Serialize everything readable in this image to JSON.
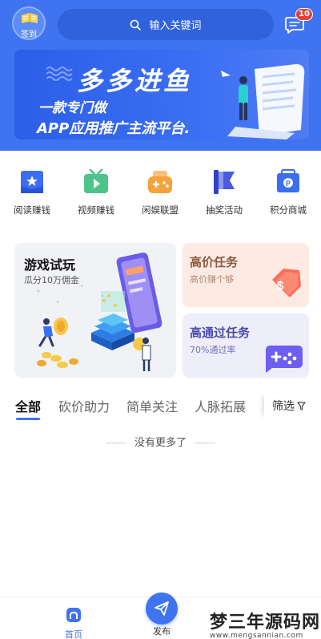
{
  "header": {
    "checkin_label": "签到",
    "search_placeholder": "输入关键词",
    "message_badge": "10",
    "accent": "#3f73f0"
  },
  "banner": {
    "title": "多多进鱼",
    "subtitle_line1": "一款专门做",
    "subtitle_line2": "APP应用推广主流平台."
  },
  "categories": [
    {
      "label": "阅读赚钱",
      "icon": "book-star-icon",
      "color": "#3b6ef3"
    },
    {
      "label": "视频赚钱",
      "icon": "video-icon",
      "color": "#4cc48a"
    },
    {
      "label": "闲娱联盟",
      "icon": "gamepad-icon",
      "color": "#f5a23b"
    },
    {
      "label": "抽奖活动",
      "icon": "flag-icon",
      "color": "#4a5be0"
    },
    {
      "label": "积分商城",
      "icon": "points-mall-icon",
      "color": "#3b6ef3"
    }
  ],
  "cards": {
    "game": {
      "title": "游戏试玩",
      "subtitle": "瓜分10万佣金"
    },
    "high_price": {
      "title": "高价任务",
      "subtitle": "高价赚个够"
    },
    "high_pass": {
      "title": "高通过任务",
      "subtitle": "70%通过率"
    }
  },
  "tabs": [
    {
      "label": "全部",
      "active": true
    },
    {
      "label": "砍价助力",
      "active": false
    },
    {
      "label": "简单关注",
      "active": false
    },
    {
      "label": "人脉拓展",
      "active": false
    }
  ],
  "filter_label": "筛选",
  "empty_text": "没有更多了",
  "tabbar": {
    "home_label": "首页",
    "publish_label": "发布"
  },
  "watermark": {
    "main": "梦三年源码网",
    "url": "www.mengsannian.com"
  }
}
